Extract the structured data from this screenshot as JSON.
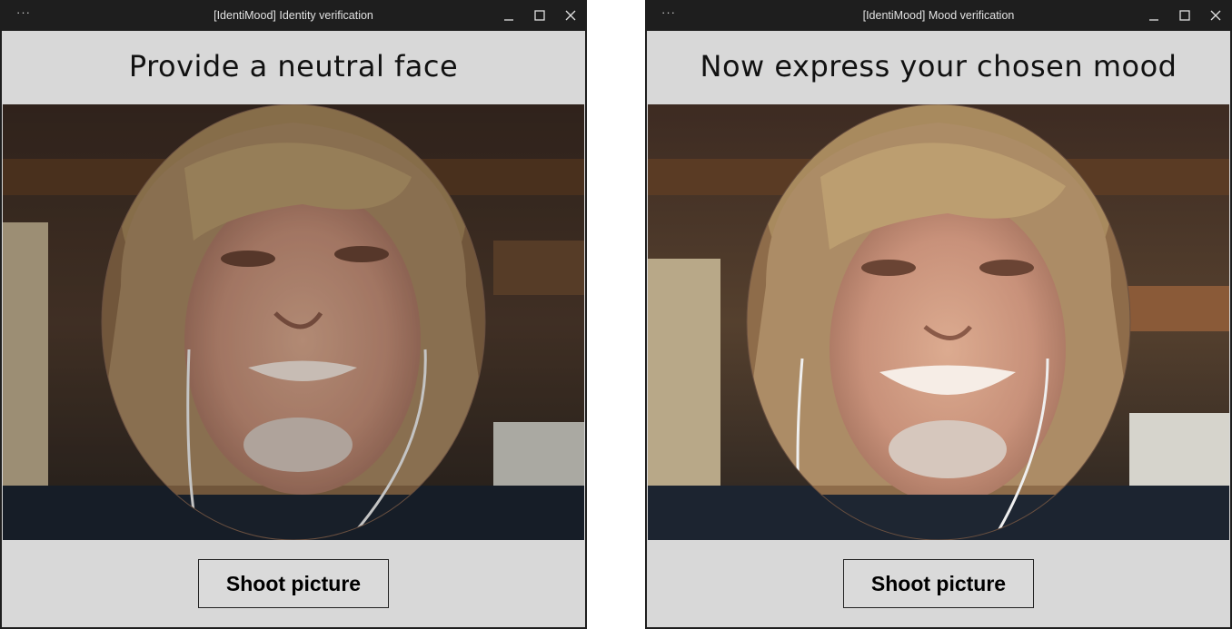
{
  "windows": [
    {
      "title": "[IdentiMood] Identity verification",
      "heading": "Provide a neutral face",
      "button_label": "Shoot picture",
      "menu_glyph": "···"
    },
    {
      "title": "[IdentiMood] Mood verification",
      "heading": "Now express your chosen mood",
      "button_label": "Shoot picture",
      "menu_glyph": "···"
    }
  ],
  "colors": {
    "titlebar": "#1e1e1e",
    "window_bg": "#d8d8d8",
    "button_border": "#222222"
  },
  "icons": [
    "menu-dots-icon",
    "minimize-icon",
    "maximize-icon",
    "close-icon"
  ]
}
